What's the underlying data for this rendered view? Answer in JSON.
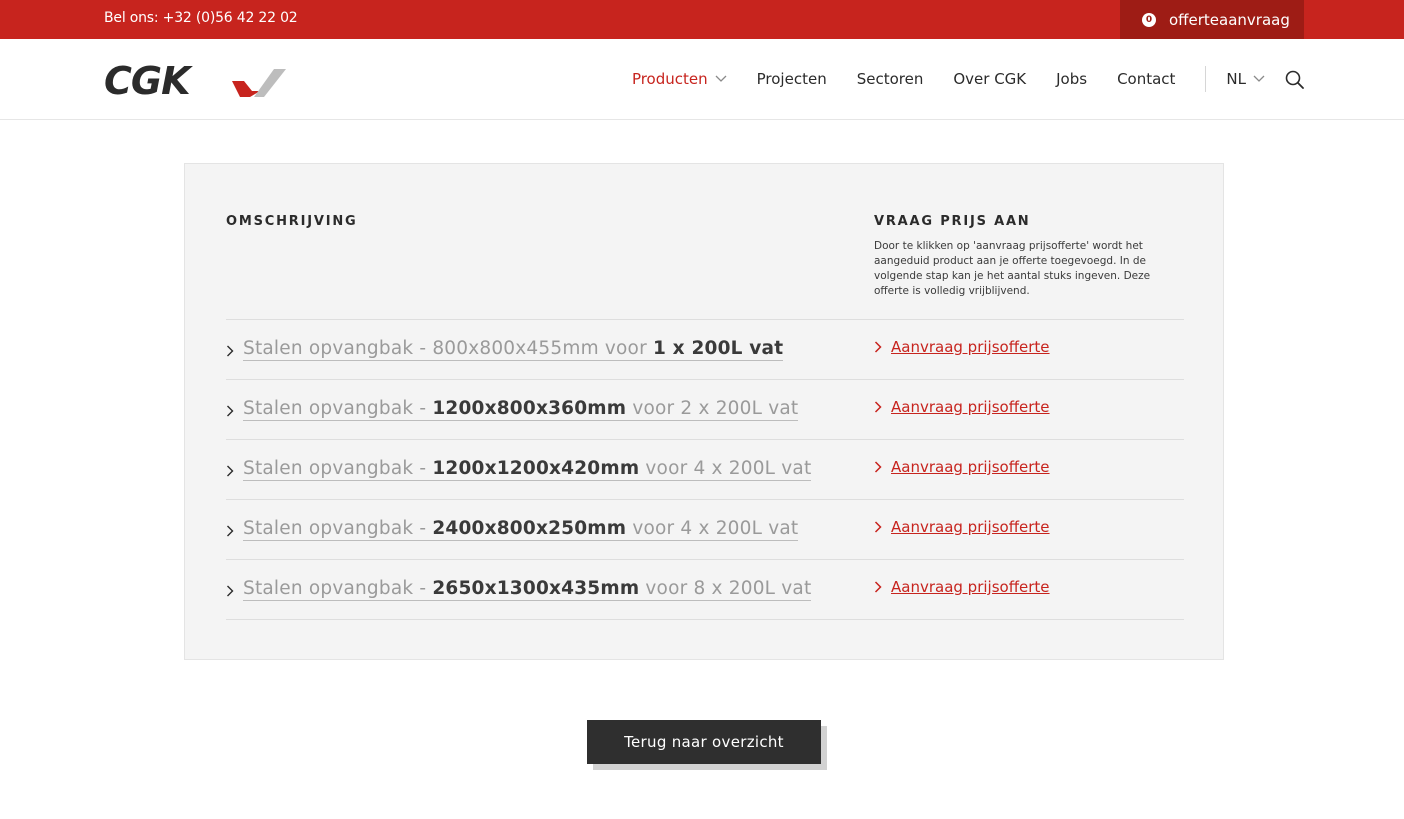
{
  "topbar": {
    "phone": "Bel ons: +32 (0)56 42 22 02",
    "quote_count": "0",
    "quote_label": "offerteaanvraag"
  },
  "header": {
    "logo_text": "CGK",
    "nav": [
      {
        "label": "Producten",
        "active": true,
        "dropdown": true
      },
      {
        "label": "Projecten"
      },
      {
        "label": "Sectoren"
      },
      {
        "label": "Over CGK"
      },
      {
        "label": "Jobs"
      },
      {
        "label": "Contact"
      }
    ],
    "language": "NL"
  },
  "panel": {
    "left_heading": "OMSCHRIJVING",
    "right_heading": "VRAAG PRIJS AAN",
    "right_description": "Door te klikken op 'aanvraag prijsofferte' wordt het aangeduid product aan je offerte toegevoegd. In de volgende stap kan je het aantal stuks ingeven. Deze offerte is volledig vrijblijvend.",
    "rows": [
      {
        "prefix": "Stalen opvangbak - ",
        "dims": "800x800x455mm",
        "dims_bold": false,
        "mid": " voor ",
        "capacity": "1 x 200L vat",
        "capacity_bold": true,
        "request": "Aanvraag prijsofferte"
      },
      {
        "prefix": "Stalen opvangbak - ",
        "dims": "1200x800x360mm",
        "dims_bold": true,
        "mid": " voor ",
        "capacity": "2 x 200L vat",
        "capacity_bold": false,
        "request": "Aanvraag prijsofferte"
      },
      {
        "prefix": "Stalen opvangbak - ",
        "dims": "1200x1200x420mm",
        "dims_bold": true,
        "mid": " voor ",
        "capacity": "4 x 200L vat",
        "capacity_bold": false,
        "request": "Aanvraag prijsofferte"
      },
      {
        "prefix": "Stalen opvangbak - ",
        "dims": "2400x800x250mm",
        "dims_bold": true,
        "mid": " voor ",
        "capacity": "4 x 200L vat",
        "capacity_bold": false,
        "request": "Aanvraag prijsofferte"
      },
      {
        "prefix": "Stalen opvangbak - ",
        "dims": "2650x1300x435mm",
        "dims_bold": true,
        "mid": " voor ",
        "capacity": "8 x 200L vat",
        "capacity_bold": false,
        "request": "Aanvraag prijsofferte"
      }
    ]
  },
  "back_button": "Terug naar overzicht",
  "colors": {
    "brand_red": "#c7241e",
    "dark_red": "#9e1c15",
    "dark_button": "#2f2f2f"
  }
}
